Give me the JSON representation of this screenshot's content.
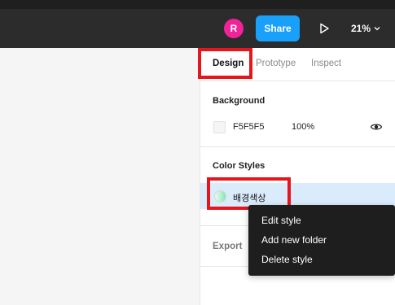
{
  "toolbar": {
    "avatar_initial": "R",
    "avatar_color": "#f0239b",
    "share_label": "Share",
    "share_color": "#18a0fb",
    "play_icon": "play-icon",
    "zoom_label": "21%",
    "zoom_icon": "chevron-down-icon"
  },
  "panel": {
    "tabs": [
      {
        "label": "Design",
        "active": true
      },
      {
        "label": "Prototype",
        "active": false
      },
      {
        "label": "Inspect",
        "active": false
      }
    ],
    "background": {
      "title": "Background",
      "hex": "F5F5F5",
      "opacity": "100%",
      "visibility_icon": "eye-icon"
    },
    "color_styles": {
      "title": "Color Styles",
      "items": [
        {
          "name": "배경색상"
        }
      ]
    },
    "export": {
      "title": "Export"
    }
  },
  "context_menu": {
    "items": [
      {
        "label": "Edit style"
      },
      {
        "label": "Add new folder"
      },
      {
        "label": "Delete style"
      }
    ]
  },
  "colors": {
    "toolbar_bg": "#2c2c2c",
    "canvas_bg": "#f5f5f5",
    "selected_row": "#daecfc",
    "highlight": "#e8141b",
    "menu_bg": "#1e1e1e"
  }
}
